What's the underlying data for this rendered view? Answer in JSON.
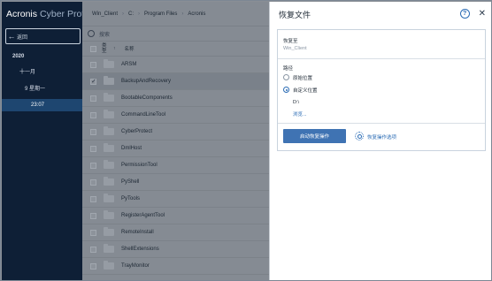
{
  "app": {
    "brand_primary": "Acronis",
    "brand_secondary": "Cyber Protect"
  },
  "sidebar": {
    "back_label": "返回",
    "tree": {
      "year": "2020",
      "month": "十一月",
      "day": "9 星期一",
      "time": "23:07"
    }
  },
  "breadcrumb": [
    "Win_Client",
    "C:",
    "Program Files",
    "Acronis"
  ],
  "search": {
    "placeholder": "搜索"
  },
  "table": {
    "col_type": "类型",
    "col_name": "名称",
    "rows": [
      {
        "name": "ARSM",
        "selected": false
      },
      {
        "name": "BackupAndRecovery",
        "selected": true
      },
      {
        "name": "BootableComponents",
        "selected": false
      },
      {
        "name": "CommandLineTool",
        "selected": false
      },
      {
        "name": "CyberProtect",
        "selected": false
      },
      {
        "name": "DmlHost",
        "selected": false
      },
      {
        "name": "PermissionTool",
        "selected": false
      },
      {
        "name": "PyShell",
        "selected": false
      },
      {
        "name": "PyTools",
        "selected": false
      },
      {
        "name": "RegisterAgentTool",
        "selected": false
      },
      {
        "name": "RemoteInstall",
        "selected": false
      },
      {
        "name": "ShellExtensions",
        "selected": false
      },
      {
        "name": "TrayMonitor",
        "selected": false
      }
    ]
  },
  "panel": {
    "title": "恢复文件",
    "restore_to_label": "恢复至",
    "restore_to_value": "Win_Client",
    "path_label": "路径",
    "option_original": "原始位置",
    "option_custom": "自定义位置",
    "custom_path": "D:\\",
    "browse_link": "浏览...",
    "start_button": "启动恢复操作",
    "options_link": "恢复操作选项",
    "selected_option": "custom"
  },
  "colors": {
    "accent": "#2b6cb5",
    "sidebar_bg": "#0e1f36",
    "selected_time_bg": "#1e4670",
    "button_bg": "#3f73b3"
  },
  "icons": {
    "back": "arrow-left-icon",
    "search": "search-icon",
    "folder": "folder-icon",
    "help": "help-icon",
    "close": "close-icon",
    "settings": "gear-icon"
  }
}
